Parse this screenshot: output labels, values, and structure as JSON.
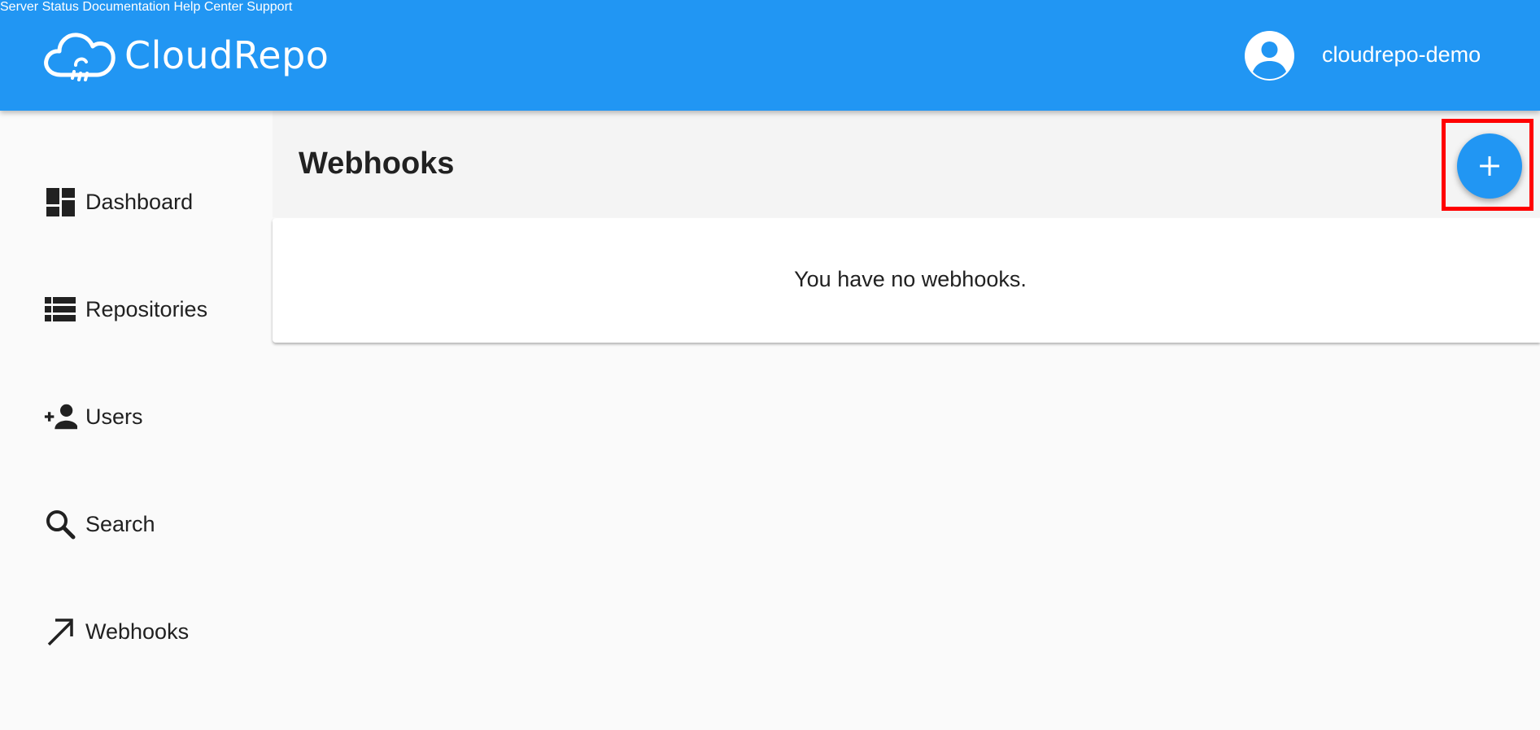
{
  "app": {
    "logo_text": "CloudRepo"
  },
  "nav": {
    "items": [
      {
        "label": "Server Status"
      },
      {
        "label": "Documentation"
      },
      {
        "label": "Help Center"
      },
      {
        "label": "Support"
      }
    ]
  },
  "user": {
    "name": "cloudrepo-demo"
  },
  "sidebar": {
    "items": [
      {
        "label": "Dashboard",
        "icon": "dashboard-icon"
      },
      {
        "label": "Repositories",
        "icon": "list-icon"
      },
      {
        "label": "Users",
        "icon": "person-add-icon"
      },
      {
        "label": "Search",
        "icon": "search-icon"
      },
      {
        "label": "Webhooks",
        "icon": "arrow-up-right-icon"
      }
    ]
  },
  "main": {
    "title": "Webhooks",
    "empty_message": "You have no webhooks.",
    "add_button_icon": "plus-icon"
  },
  "colors": {
    "primary": "#2196f3",
    "highlight": "#ff0000"
  }
}
